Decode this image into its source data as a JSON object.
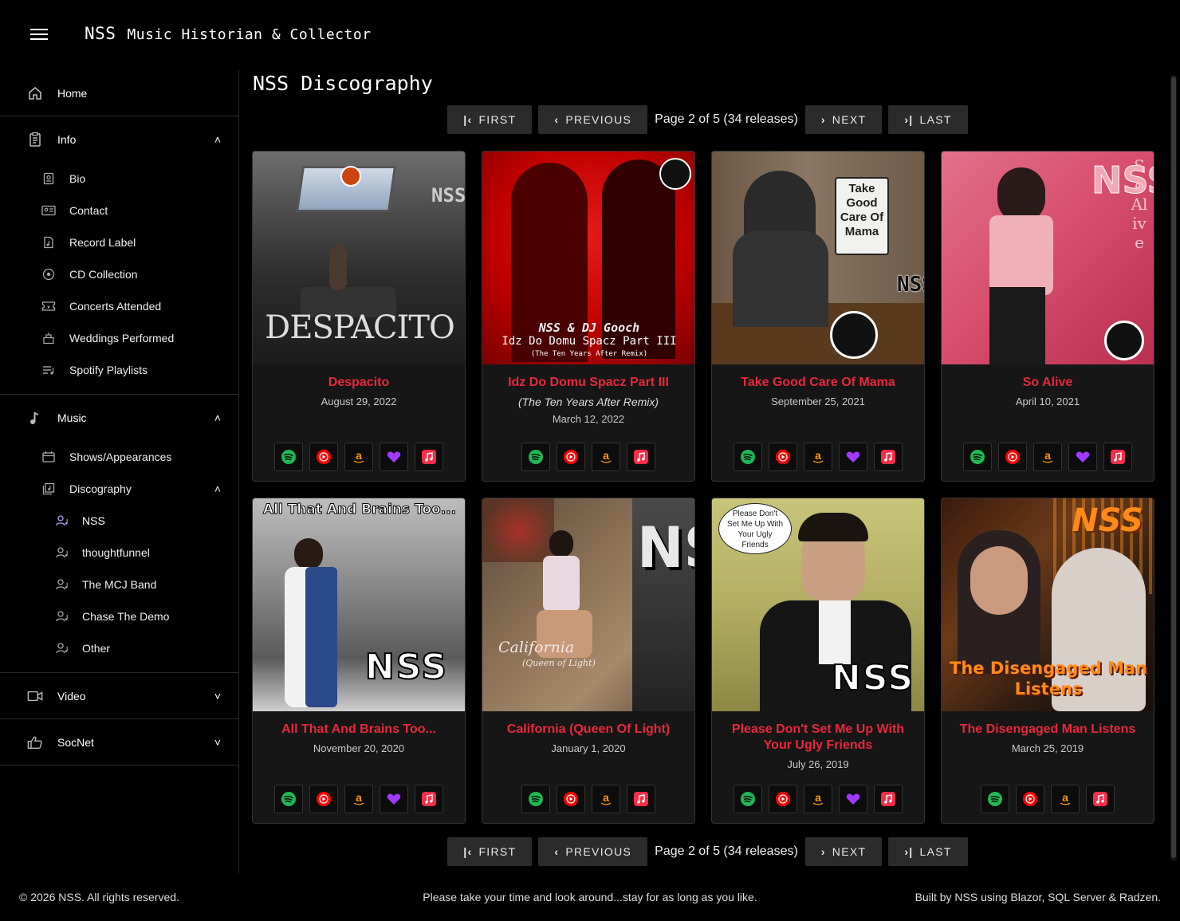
{
  "header": {
    "brand": "NSS",
    "subtitle": "Music Historian & Collector"
  },
  "sidebar": {
    "home": "Home",
    "info": {
      "label": "Info",
      "items": [
        "Bio",
        "Contact",
        "Record Label",
        "CD Collection",
        "Concerts Attended",
        "Weddings Performed",
        "Spotify Playlists"
      ]
    },
    "music": {
      "label": "Music",
      "shows": "Shows/Appearances",
      "discography": "Discography",
      "artists": [
        "NSS",
        "thoughtfunnel",
        "The MCJ Band",
        "Chase The Demo",
        "Other"
      ]
    },
    "video": "Video",
    "socnet": "SocNet"
  },
  "main": {
    "title": "NSS Discography",
    "pager": {
      "first": "FIRST",
      "previous": "PREVIOUS",
      "status": "Page 2 of 5 (34 releases)",
      "next": "NEXT",
      "last": "LAST"
    },
    "releases": [
      {
        "title": "Despacito",
        "subtitle": "",
        "date": "August 29, 2022",
        "cover_text": "DESPACITO",
        "cover_side": "NSS",
        "links": [
          "spotify",
          "youtube-music",
          "amazon",
          "deezer",
          "apple-music"
        ]
      },
      {
        "title": "Idz Do Domu Spacz Part III",
        "subtitle": "(The Ten Years After Remix)",
        "date": "March 12, 2022",
        "cover_text": "Idz Do Domu Spacz Part III",
        "cover_top": "NSS & DJ Gooch",
        "cover_small": "(The Ten Years After Remix)",
        "links": [
          "spotify",
          "youtube-music",
          "amazon",
          "apple-music"
        ]
      },
      {
        "title": "Take Good Care Of Mama",
        "subtitle": "",
        "date": "September 25, 2021",
        "cover_sign": "Take Good Care Of Mama",
        "cover_side": "NSS",
        "links": [
          "spotify",
          "youtube-music",
          "amazon",
          "deezer",
          "apple-music"
        ]
      },
      {
        "title": "So Alive",
        "subtitle": "",
        "date": "April 10, 2021",
        "cover_side": "NSS",
        "cover_text": "So Alive",
        "links": [
          "spotify",
          "youtube-music",
          "amazon",
          "deezer",
          "apple-music"
        ]
      },
      {
        "title": "All That And Brains Too...",
        "subtitle": "",
        "date": "November 20, 2020",
        "cover_text": "All That And Brains Too...",
        "cover_side": "NSS",
        "links": [
          "spotify",
          "youtube-music",
          "amazon",
          "deezer",
          "apple-music"
        ]
      },
      {
        "title": "California (Queen Of Light)",
        "subtitle": "",
        "date": "January 1, 2020",
        "cover_side": "NSS",
        "cover_text": "California",
        "cover_small": "(Queen of Light)",
        "links": [
          "spotify",
          "youtube-music",
          "amazon",
          "apple-music"
        ]
      },
      {
        "title": "Please Don't Set Me Up With Your Ugly Friends",
        "subtitle": "",
        "date": "July 26, 2019",
        "cover_text": "Please Don't Set Me Up With Your Ugly Friends",
        "cover_side": "NSS",
        "links": [
          "spotify",
          "youtube-music",
          "amazon",
          "deezer",
          "apple-music"
        ]
      },
      {
        "title": "The Disengaged Man Listens",
        "subtitle": "",
        "date": "March 25, 2019",
        "cover_side": "NSS",
        "cover_text": "The Disengaged Man Listens",
        "links": [
          "spotify",
          "youtube-music",
          "amazon",
          "apple-music"
        ]
      }
    ]
  },
  "footer": {
    "copyright": "© 2026 NSS. All rights reserved.",
    "tagline": "Please take your time and look around...stay for as long as you like.",
    "built": "Built by NSS using Blazor, SQL Server & Radzen."
  },
  "colors": {
    "accent": "#e8283b",
    "spotify": "#1db954",
    "youtube": "#ff0000",
    "amazon": "#ff9900",
    "deezer": "#a238ff",
    "apple": "#fa2d48"
  }
}
